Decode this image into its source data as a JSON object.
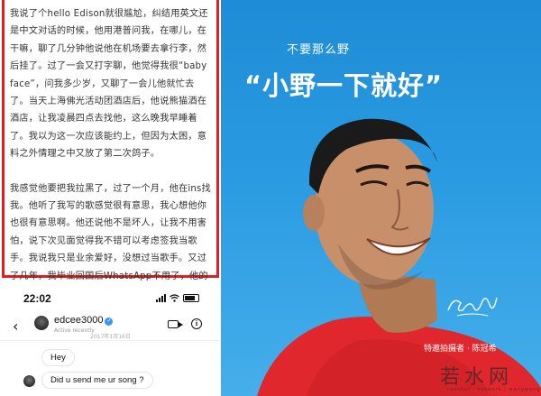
{
  "article": {
    "paragraphs": [
      "我说了个hello Edison就很尴尬，纠结用英文还是中文对话的时候，他用港普问我，在哪儿，在干嘛，聊了几分钟他说他在机场要去拿行李，然后挂了。过了一会又打字聊，他觉得我很“baby face”，问我多少岁，又聊了一会儿他就忙去了。当天上海佛光活动团酒店后，他说熊猫酒在酒店，让我凌晨四点去找他，这么晚我早睡着了。我以为这一次应该能约上，但因为太困，意料之外情理之中又放了第二次鸽子。",
      "我感觉他要把我拉黑了，过了一个月，他在ins找我。他听了我写的歌感觉很有意思，我心想他你也很有意思啊。他还说他不是坏人，让我不用害怕，说下次见面觉得我不错可以考虑签我当歌手。我说我只是业余爱好，没想过当歌手。又过了几年，我毕业回国后WhatsApp不用了，他的微信也不用了，我们就再也没联系了。"
    ]
  },
  "phone": {
    "time": "22:02",
    "chat": {
      "name": "edcee3000",
      "verified_mark": "✓",
      "sub": "Active recently",
      "date": "2017年1月16日",
      "messages": [
        "Hey",
        "Did u send me ur song ?"
      ]
    },
    "icons": [
      "back-icon",
      "video-icon",
      "info-icon",
      "wifi-icon",
      "battery-icon"
    ]
  },
  "poster": {
    "subtitle": "不要那么野",
    "slogan": "“小野一下就好”",
    "credit": "特邀拍摄者 · 陈冠希",
    "background": "#2a9be2"
  },
  "watermark": {
    "text": "若水网",
    "small": "ruoshui · network · wangwang"
  }
}
